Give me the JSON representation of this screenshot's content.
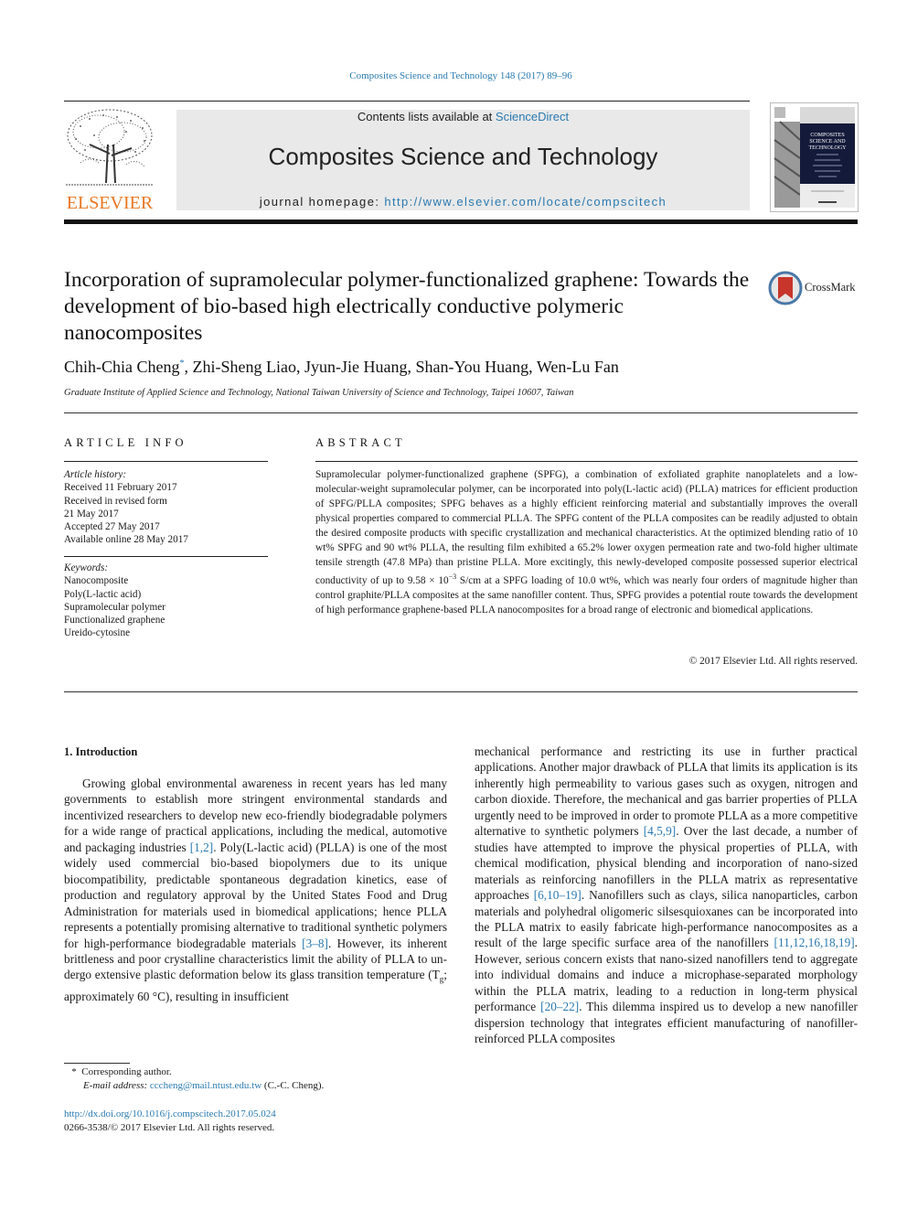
{
  "header": {
    "journal_reference": "Composites Science and Technology 148 (2017) 89–96",
    "contents_prefix": "Contents lists available at ",
    "contents_link": "ScienceDirect",
    "journal_title": "Composites Science and Technology",
    "homepage_prefix": "journal homepage: ",
    "homepage_url": "http://www.elsevier.com/locate/compscitech",
    "publisher": "ELSEVIER",
    "cover_title_lines": [
      "COMPOSITES",
      "SCIENCE AND",
      "TECHNOLOGY"
    ],
    "crossmark_label": "CrossMark"
  },
  "article": {
    "title": "Incorporation of supramolecular polymer-functionalized graphene: Towards the development of bio-based high electrically conductive polymeric nanocomposites",
    "authors": [
      {
        "name": "Chih-Chia Cheng",
        "marker": "*",
        "sep": ", "
      },
      {
        "name": "Zhi-Sheng Liao",
        "marker": "",
        "sep": ", "
      },
      {
        "name": "Jyun-Jie Huang",
        "marker": "",
        "sep": ", "
      },
      {
        "name": "Shan-You Huang",
        "marker": "",
        "sep": ", "
      },
      {
        "name": "Wen-Lu Fan",
        "marker": "",
        "sep": ""
      }
    ],
    "affiliation": "Graduate Institute of Applied Science and Technology, National Taiwan University of Science and Technology, Taipei 10607, Taiwan"
  },
  "article_info": {
    "heading": "ARTICLE INFO",
    "history_label": "Article history:",
    "history": [
      "Received 11 February 2017",
      "Received in revised form",
      "21 May 2017",
      "Accepted 27 May 2017",
      "Available online 28 May 2017"
    ],
    "keywords_label": "Keywords:",
    "keywords": [
      "Nanocomposite",
      "Poly(L-lactic acid)",
      "Supramolecular polymer",
      "Functionalized graphene",
      "Ureido-cytosine"
    ]
  },
  "abstract": {
    "heading": "ABSTRACT",
    "text_part1": "Supramolecular polymer-functionalized graphene (SPFG), a combination of exfoliated graphite nano­platelets and a low-molecular-weight supramolecular polymer, can be incorporated into poly(L-lactic acid) (PLLA) matrices for efficient production of SPFG/PLLA composites; SPFG behaves as a highly efficient reinforcing material and substantially improves the overall physical properties compared to commercial PLLA. The SPFG content of the PLLA composites can be readily adjusted to obtain the desired composite products with specific crystallization and mechanical characteristics. At the optimized blending ratio of 10 wt% SPFG and 90 wt% PLLA, the resulting film exhibited a 65.2% lower oxygen permeation rate and two-fold higher ultimate tensile strength (47.8 MPa) than pristine PLLA. More excitingly, this newly-developed composite possessed superior electrical conductivity of up to 9.58 × 10",
    "exponent": "−3",
    "text_part2": " S/cm at a SPFG loading of 10.0 wt%, which was nearly four orders of magnitude higher than control graphite/PLLA composites at the same nanofiller content. Thus, SPFG provides a potential route towards the develop­ment of high performance graphene-based PLLA nanocomposites for a broad range of electronic and biomedical applications.",
    "copyright": "© 2017 Elsevier Ltd. All rights reserved."
  },
  "introduction": {
    "heading": "1.  Introduction",
    "left": [
      {
        "t": "Growing global environmental awareness in recent years has led many governments to establish more stringent environmental standards and incentivized researchers to develop new eco-friendly biodegradable polymers for a wide range of practical ap­plications, including the medical, automotive and packaging in­dustries "
      },
      {
        "ref": "[1,2]"
      },
      {
        "t": ". Poly(L-lactic acid) (PLLA) is one of the most widely used commercial bio-based biopolymers due to its unique biocompatibility, predictable spontaneous degradation kinetics, ease of production and regulatory approval by the United States Food and Drug Administration for materials used in biomedical applications; hence PLLA represents a potentially promising alter­native to traditional synthetic polymers for high-performance biodegradable materials "
      },
      {
        "ref": "[3–8]"
      },
      {
        "t": ". However, its inherent brittleness and poor crystalline characteristics limit the ability of PLLA to un­dergo extensive plastic deformation below its glass transition temperature (T"
      },
      {
        "sub": "g"
      },
      {
        "t": "; approximately 60 °C), resulting in insufficient"
      }
    ],
    "right": [
      {
        "t": "mechanical performance and restricting its use in further practical applications. Another major drawback of PLLA that limits its application is its inherently high permeability to various gases such as oxygen, nitrogen and carbon dioxide. Therefore, the mechanical and gas barrier properties of PLLA urgently need to be improved in order to promote PLLA as a more competitive alternative to syn­thetic polymers "
      },
      {
        "ref": "[4,5,9]"
      },
      {
        "t": ". Over the last decade, a number of studies have attempted to improve the physical properties of PLLA, with chemical modification, physical blending and incorporation of nano-sized materials as reinforcing nanofillers in the PLLA matrix as representative approaches "
      },
      {
        "ref": "[6,10–19]"
      },
      {
        "t": ". Nanofillers such as clays, silica nanoparticles, carbon materials and polyhedral oligomeric silsesquioxanes can be incorporated into the PLLA matrix to easily fabricate high-performance nanocomposites as a result of the large specific surface area of the nanofillers "
      },
      {
        "ref": "[11,12,16,18,19]"
      },
      {
        "t": ". However, serious concern exists that nano-sized nanofillers tend to aggregate into individual domains and induce a microphase-separated morphology within the PLLA matrix, leading to a reduction in long-term physical performance "
      },
      {
        "ref": "[20–22]"
      },
      {
        "t": ". This dilemma inspired us to develop a new nanofiller dispersion technology that integrates efficient manufacturing of nanofiller-reinforced PLLA composites"
      }
    ]
  },
  "footnotes": {
    "corresponding_marker": "*",
    "corresponding_text": "Corresponding author.",
    "email_label": "E-mail address: ",
    "email": "cccheng@mail.ntust.edu.tw",
    "email_suffix": " (C.-C. Cheng).",
    "doi_url": "http://dx.doi.org/10.1016/j.compscitech.2017.05.024",
    "issn_copyright": "0266-3538/© 2017 Elsevier Ltd. All rights reserved."
  },
  "colors": {
    "link": "#2a7ab0",
    "elsevier_orange": "#e87722",
    "masthead_bg": "#e9e9e9",
    "crossmark_red": "#c8352b",
    "crossmark_ring": "#4a78a8"
  }
}
